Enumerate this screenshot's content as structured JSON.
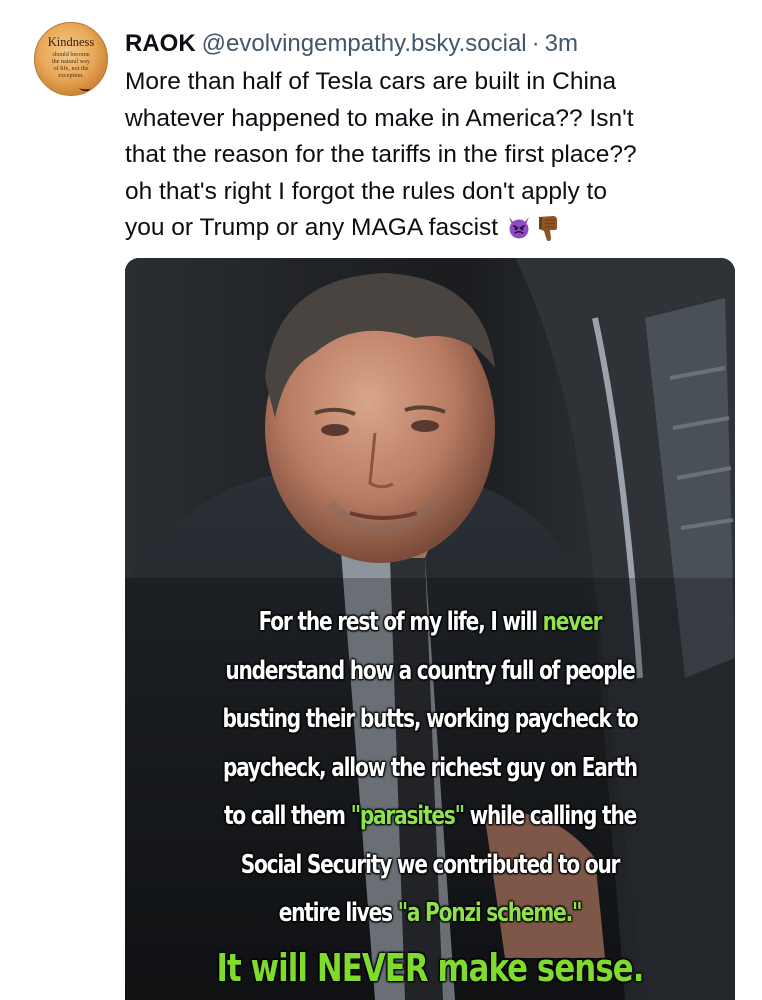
{
  "author": {
    "display_name": "RAOK",
    "handle": "@evolvingempathy.bsky.social",
    "separator": "·",
    "timestamp": "3m",
    "avatar": {
      "title": "Kindness",
      "lines": [
        "should become",
        "the natural way",
        "of life, not the",
        "exception."
      ]
    }
  },
  "post": {
    "lines": [
      "More than half of Tesla cars are built in China",
      "whatever happened to make in America?? Isn't",
      "that the reason for the tariffs in the first place??",
      "oh that's right I forgot the rules don't apply to",
      "you or Trump or any MAGA fascist"
    ],
    "emojis": [
      "devil-icon",
      "thumbs-down-icon"
    ]
  },
  "image": {
    "lines": [
      {
        "before": "For the rest of my life, I will ",
        "highlight": "never",
        "after": ""
      },
      {
        "before": "understand how a country full of people",
        "highlight": "",
        "after": ""
      },
      {
        "before": "busting their butts, working paycheck to",
        "highlight": "",
        "after": ""
      },
      {
        "before": "paycheck, allow the richest guy on Earth",
        "highlight": "",
        "after": ""
      },
      {
        "before": "to call them ",
        "highlight": "\"parasites\"",
        "after": " while calling the"
      },
      {
        "before": "Social Security we contributed to our",
        "highlight": "",
        "after": ""
      },
      {
        "before": "entire lives ",
        "highlight": "\"a Ponzi scheme.\"",
        "after": ""
      }
    ],
    "final_line": "It will NEVER make sense.",
    "highlight_color": "#8fe34a"
  }
}
